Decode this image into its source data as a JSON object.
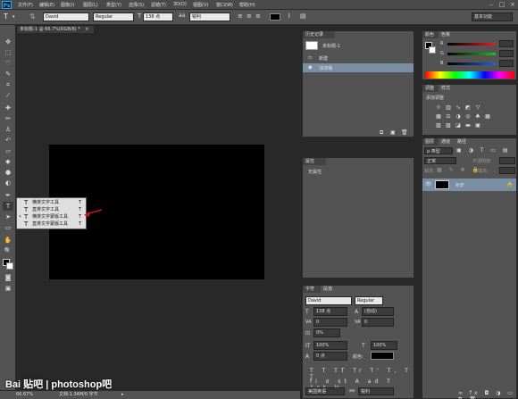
{
  "app": {
    "logo": "Ps"
  },
  "menu": [
    "文件(F)",
    "编辑(E)",
    "图像(I)",
    "图层(L)",
    "类型(Y)",
    "选择(S)",
    "滤镜(T)",
    "3D(D)",
    "视图(V)",
    "窗口(W)",
    "帮助(H)"
  ],
  "options": {
    "font_family": "David",
    "font_style": "Regular",
    "font_size": "138 点",
    "antialias": "锐利",
    "workspace": "基本功能"
  },
  "document": {
    "tab_title": "未标题-1 @ 66.7%(RGB/8) *",
    "canvas_color": "#000000"
  },
  "type_flyout": {
    "items": [
      {
        "label": "横排文字工具",
        "key": "T",
        "selected": false
      },
      {
        "label": "直排文字工具",
        "key": "T",
        "selected": false
      },
      {
        "label": "横排文字蒙版工具",
        "key": "T",
        "selected": true
      },
      {
        "label": "直排文字蒙版工具",
        "key": "T",
        "selected": false
      }
    ]
  },
  "history": {
    "tab": "历史记录",
    "snapshot": "未标题-1",
    "items": [
      "新建",
      "油漆桶"
    ]
  },
  "properties": {
    "tab": "属性",
    "empty_text": "无属性"
  },
  "character": {
    "tabs": [
      "字符",
      "段落"
    ],
    "font_family": "David",
    "font_style": "Regular",
    "font_size": "138 点",
    "leading": "(自动)",
    "kerning": "0",
    "tracking": "0",
    "scale_label": "0%",
    "vertical_scale": "100%",
    "horizontal_scale": "100%",
    "baseline": "0 点",
    "color_label": "颜色:",
    "language": "美国英语",
    "antialias": "锐利"
  },
  "color_panel": {
    "tabs": [
      "颜色",
      "色板"
    ],
    "channels": [
      {
        "label": "R",
        "value": "",
        "color": "#e02020"
      },
      {
        "label": "G",
        "value": "",
        "color": "#20c020"
      },
      {
        "label": "B",
        "value": "",
        "color": "#2060e0"
      }
    ]
  },
  "adjustments": {
    "tabs": [
      "调整",
      "样式"
    ],
    "title": "添加调整"
  },
  "layers": {
    "tabs": [
      "图层",
      "通道",
      "路径"
    ],
    "filter": "ρ 类型",
    "blend_mode": "正常",
    "opacity_label": "不透明度:",
    "lock_label": "锁定:",
    "fill_label": "填充:",
    "layer_name": "背景"
  },
  "status": {
    "zoom": "66.67%",
    "doc_info": "文档:1.34M/0 字节"
  },
  "watermark": {
    "text": "Bai 贴吧 | photoshop吧"
  }
}
